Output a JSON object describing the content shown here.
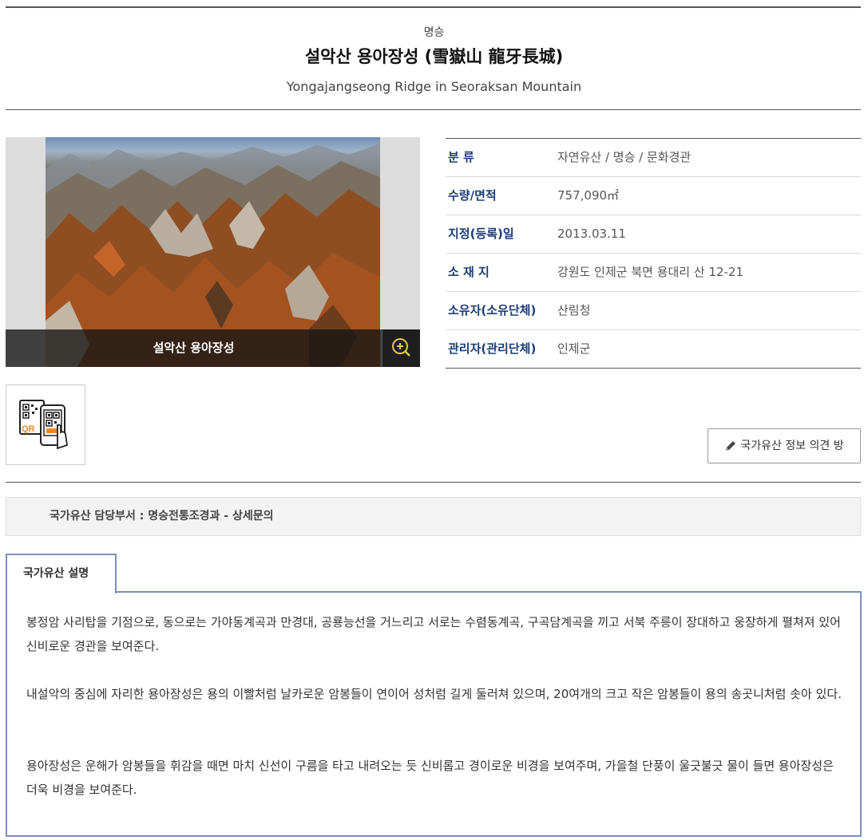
{
  "header": {
    "category": "명승",
    "title": "설악산 용아장성 (雪嶽山 龍牙長城)",
    "english_title": "Yongajangseong Ridge in Seoraksan Mountain"
  },
  "photo": {
    "caption": "설악산 용아장성",
    "zoom_icon": "zoom-in-icon"
  },
  "info": [
    {
      "label": "분 류",
      "value": "자연유산 / 명승 / 문화경관"
    },
    {
      "label": "수량/면적",
      "value": "757,090㎡"
    },
    {
      "label": "지정(등록)일",
      "value": "2013.03.11"
    },
    {
      "label": "소 재 지",
      "value": "강원도 인제군 북면 용대리 산 12-21"
    },
    {
      "label": "소유자(소유단체)",
      "value": "산림청"
    },
    {
      "label": "관리자(관리단체)",
      "value": "인제군"
    }
  ],
  "qr": {
    "icon": "qr-code-icon",
    "label": "QR"
  },
  "opinion_button": {
    "label": "국가유산 정보 의견 방",
    "icon": "pencil-icon"
  },
  "department": {
    "prefix": "국가유산 담당부서 : 명승전통조경과 - ",
    "link": "상세문의"
  },
  "description": {
    "tab_label": "국가유산 설명",
    "paragraphs": [
      "봉정암 사리탑을 기점으로, 동으로는 가야동계곡과 만경대, 공룡능선을 거느리고 서로는 수렴동계곡, 구곡담계곡을 끼고 서북 주릉이 장대하고 웅장하게 펼쳐져 있어 신비로운 경관을 보여준다.",
      "내설악의 중심에 자리한 용아장성은 용의 이빨처럼 날카로운 암봉들이 연이어 성처럼 길게 둘러쳐 있으며, 20여개의 크고 작은 암봉들이 용의 송곳니처럼 솟아 있다.",
      "용아장성은 운해가 암봉들을 휘감을 때면 마치 신선이 구름을 타고 내려오는 듯 신비롭고 경이로운 비경을 보여주며, 가을철 단풍이 울긋불긋 물이 들면 용아장성은 더욱 비경을 보여준다."
    ]
  },
  "colors": {
    "label_blue": "#1d3d74",
    "tab_border": "#7b8fc0",
    "qr_orange": "#f08a24"
  }
}
